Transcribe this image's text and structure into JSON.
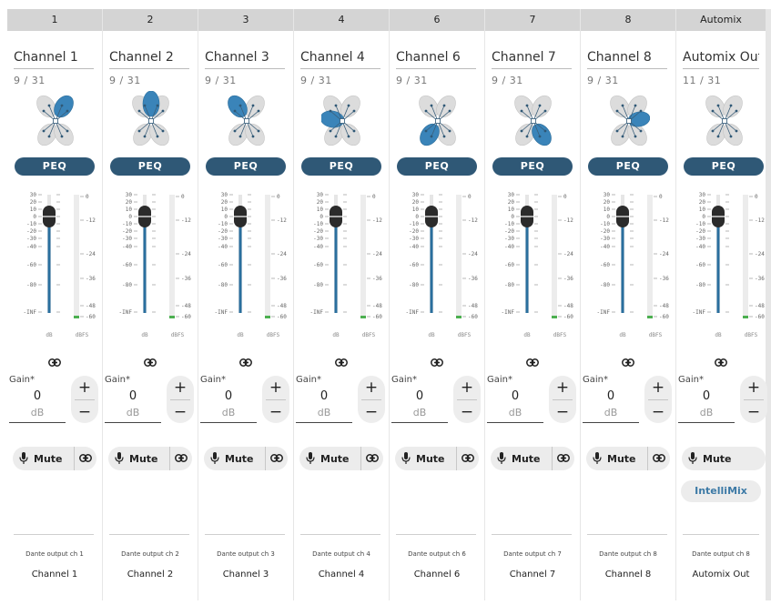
{
  "labels": {
    "peq": "PEQ",
    "gain": "Gain*",
    "gain_unit": "dB",
    "mute": "Mute",
    "plus": "+",
    "minus": "−",
    "link": "⊖",
    "intellimix": "IntelliMix",
    "db": "dB",
    "dbfs": "dBFS",
    "fader_scale": [
      "30",
      "20",
      "10",
      "0",
      "-10",
      "-20",
      "-30",
      "-40",
      "-60",
      "-80",
      "-INF"
    ],
    "meter_scale": [
      "0",
      "-12",
      "-24",
      "-36",
      "-48",
      "-60"
    ]
  },
  "icons": {
    "mute": "microphone-icon",
    "link": "link-icon"
  },
  "colors": {
    "peq": "#2f5876",
    "lobe_active": "#3a84b9",
    "fader_line": "#2a6f9e",
    "intellimix_text": "#3d7aa6"
  },
  "channels": [
    {
      "header": "1",
      "name": "Channel 1",
      "preset": "9 / 31",
      "gain": "0",
      "active_lobe": "right",
      "fader_db": 0,
      "dante": "Dante output ch 1",
      "footer": "Channel 1"
    },
    {
      "header": "2",
      "name": "Channel 2",
      "preset": "9 / 31",
      "gain": "0",
      "active_lobe": "top",
      "fader_db": 0,
      "dante": "Dante output ch 2",
      "footer": "Channel 2"
    },
    {
      "header": "3",
      "name": "Channel 3",
      "preset": "9 / 31",
      "gain": "0",
      "active_lobe": "topleft",
      "fader_db": 0,
      "dante": "Dante output ch 3",
      "footer": "Channel 3"
    },
    {
      "header": "4",
      "name": "Channel 4",
      "preset": "9 / 31",
      "gain": "0",
      "active_lobe": "left",
      "fader_db": 0,
      "dante": "Dante output ch 4",
      "footer": "Channel 4"
    },
    {
      "header": "6",
      "name": "Channel 6",
      "preset": "9 / 31",
      "gain": "0",
      "active_lobe": "bottomleft",
      "fader_db": 0,
      "dante": "Dante output ch 6",
      "footer": "Channel 6"
    },
    {
      "header": "7",
      "name": "Channel 7",
      "preset": "9 / 31",
      "gain": "0",
      "active_lobe": "bottomright",
      "fader_db": 0,
      "dante": "Dante output ch 7",
      "footer": "Channel 7"
    },
    {
      "header": "8",
      "name": "Channel 8",
      "preset": "9 / 31",
      "gain": "0",
      "active_lobe": "rightsmall",
      "fader_db": 0,
      "dante": "Dante output ch 8",
      "footer": "Channel 8"
    },
    {
      "header": "Automix",
      "name": "Automix Out",
      "preset": "11 / 31",
      "gain": "0",
      "active_lobe": "none",
      "fader_db": 0,
      "dante": "Dante output ch 8",
      "footer": "Automix Out",
      "automix": true
    }
  ]
}
